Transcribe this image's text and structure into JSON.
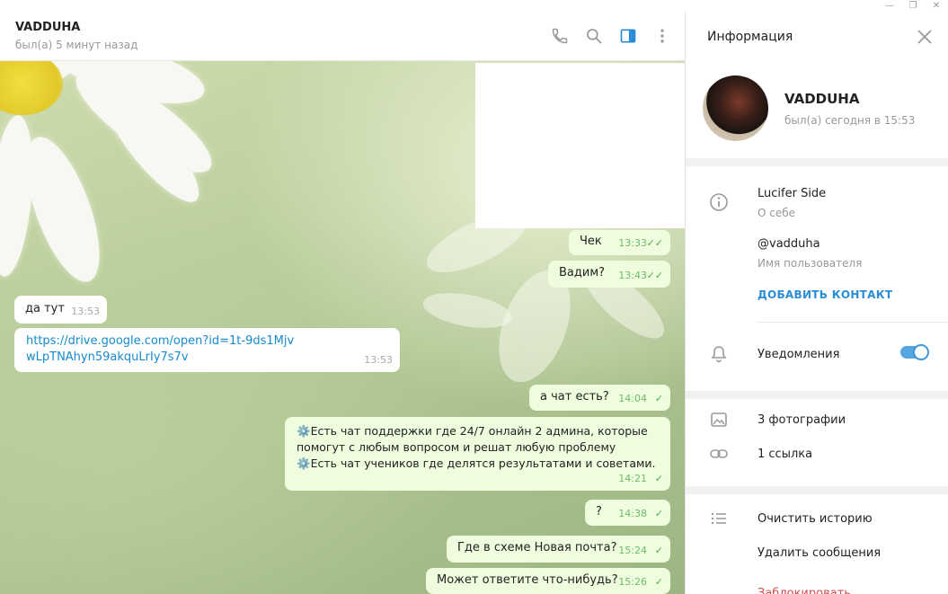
{
  "window": {
    "minimize": "—",
    "maximize": "❐",
    "close": "✕"
  },
  "chat": {
    "title": "VADDUHA",
    "status": "был(а) 5 минут назад",
    "messages": [
      {
        "id": "m1",
        "dir": "out",
        "text": "Чек",
        "time": "13:33",
        "ticks": "✓✓"
      },
      {
        "id": "m2",
        "dir": "out",
        "text": "Вадим?",
        "time": "13:43",
        "ticks": "✓✓"
      },
      {
        "id": "m3",
        "dir": "in",
        "text": "да тут",
        "time": "13:53"
      },
      {
        "id": "m4",
        "dir": "in",
        "text": "https://drive.google.com/open?id=1t-9ds1MjvwLpTNAhyn59akquLrIy7s7v",
        "time": "13:53"
      },
      {
        "id": "m5",
        "dir": "out",
        "text": "а чат есть?",
        "time": "14:04",
        "ticks": "✓"
      },
      {
        "id": "m6",
        "dir": "out",
        "line1": "⚙️Есть чат поддержки где 24/7 онлайн 2 админа, которые",
        "line2": "помогут с любым вопросом и решат любую проблему",
        "line3": "⚙️Есть чат учеников где делятся результатами и советами.",
        "time": "14:21",
        "ticks": "✓"
      },
      {
        "id": "m7",
        "dir": "out",
        "text": "?",
        "time": "14:38",
        "ticks": "✓"
      },
      {
        "id": "m8",
        "dir": "out",
        "text": "Где в схеме Новая почта?",
        "time": "15:24",
        "ticks": "✓"
      },
      {
        "id": "m9",
        "dir": "out",
        "text": "Может ответите что-нибудь?",
        "time": "15:26",
        "ticks": "✓"
      }
    ]
  },
  "panel": {
    "title": "Информация",
    "profile": {
      "name": "VADDUHA",
      "status": "был(а) сегодня в 15:53"
    },
    "bio": {
      "value": "Lucifer Side",
      "label": "О себе"
    },
    "username": {
      "value": "@vadduha",
      "label": "Имя пользователя"
    },
    "add_contact": "ДОБАВИТЬ КОНТАКТ",
    "notifications": {
      "label": "Уведомления",
      "enabled": true
    },
    "media": {
      "photos": "3 фотографии",
      "links": "1 ссылка"
    },
    "actions": {
      "clear": "Очистить историю",
      "delete": "Удалить сообщения",
      "block": "Заблокировать"
    }
  },
  "colors": {
    "accent": "#2a8dd8",
    "out_bubble": "#effdde",
    "ticks": "#4fae4e",
    "danger": "#d14e4e"
  },
  "icons": {
    "call": "phone-icon",
    "search": "search-icon",
    "sidebar": "sidebar-toggle-icon",
    "menu": "more-vertical-icon"
  }
}
